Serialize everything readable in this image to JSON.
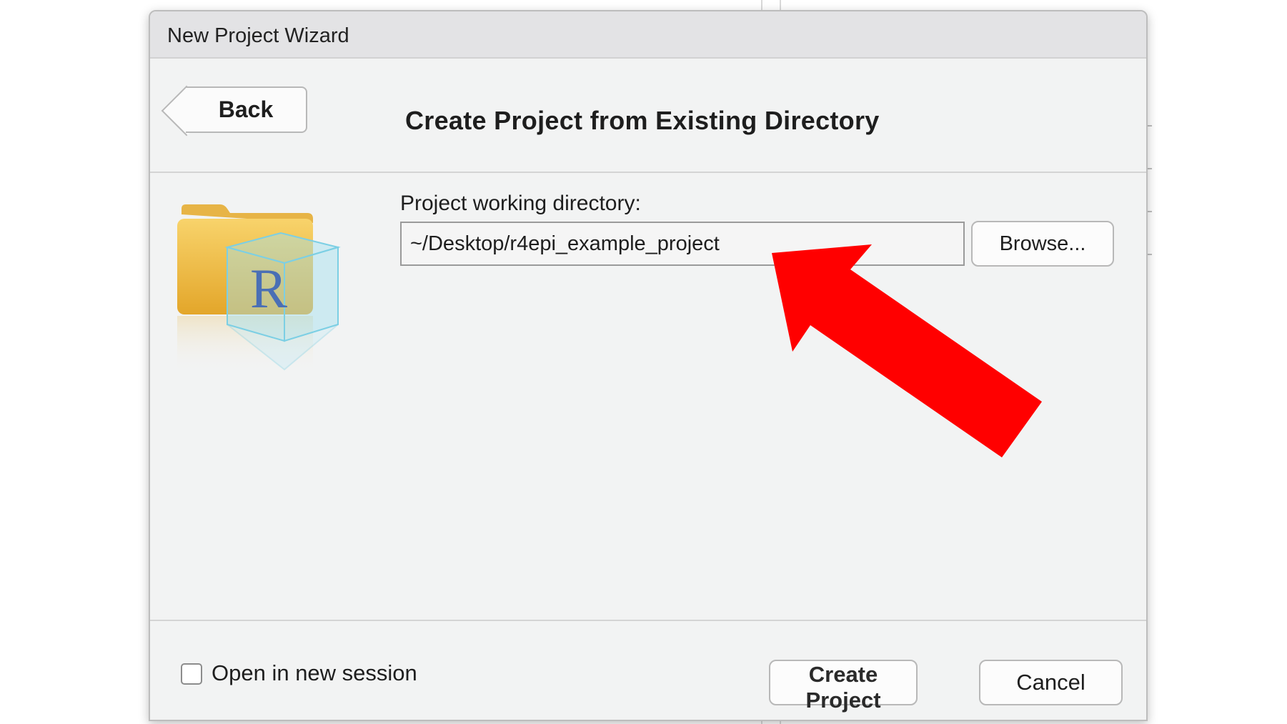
{
  "window": {
    "title": "New Project Wizard"
  },
  "header": {
    "back_label": "Back",
    "title": "Create Project from Existing Directory"
  },
  "form": {
    "directory_label": "Project working directory:",
    "directory_value": "~/Desktop/r4epi_example_project",
    "browse_label": "Browse..."
  },
  "footer": {
    "new_session_label": "Open in new session",
    "new_session_checked": false,
    "create_label": "Create Project",
    "cancel_label": "Cancel"
  },
  "icons": {
    "project": "r-project-folder-icon",
    "annotation": "red-arrow-icon"
  },
  "colors": {
    "annotation_arrow": "#ff0000",
    "folder": "#f2b632",
    "r_cube": "#7fd3ea",
    "r_letter": "#4a6fb5"
  }
}
